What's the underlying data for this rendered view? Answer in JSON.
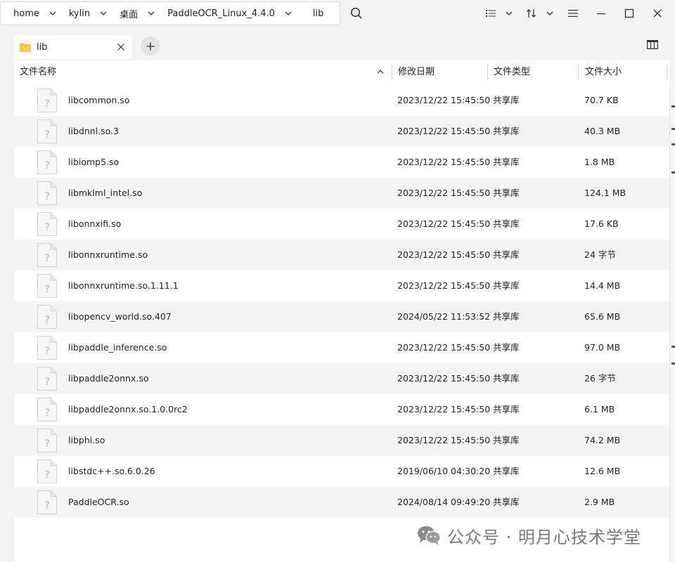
{
  "breadcrumb": [
    "home",
    "kylin",
    "桌面",
    "PaddleOCR_Linux_4.4.0",
    "lib"
  ],
  "tab": {
    "label": "lib"
  },
  "columns": {
    "name": "文件名称",
    "date": "修改日期",
    "type": "文件类型",
    "size": "文件大小"
  },
  "sort": {
    "column": "name",
    "direction": "ascending"
  },
  "files": [
    {
      "name": "libcommon.so",
      "date": "2023/12/22 15:45:50",
      "type": "共享库",
      "size": "70.7 KB"
    },
    {
      "name": "libdnnl.so.3",
      "date": "2023/12/22 15:45:50",
      "type": "共享库",
      "size": "40.3 MB"
    },
    {
      "name": "libiomp5.so",
      "date": "2023/12/22 15:45:50",
      "type": "共享库",
      "size": "1.8 MB"
    },
    {
      "name": "libmklml_intel.so",
      "date": "2023/12/22 15:45:50",
      "type": "共享库",
      "size": "124.1 MB"
    },
    {
      "name": "libonnxifi.so",
      "date": "2023/12/22 15:45:50",
      "type": "共享库",
      "size": "17.6 KB"
    },
    {
      "name": "libonnxruntime.so",
      "date": "2023/12/22 15:45:50",
      "type": "共享库",
      "size": "24 字节"
    },
    {
      "name": "libonnxruntime.so.1.11.1",
      "date": "2023/12/22 15:45:50",
      "type": "共享库",
      "size": "14.4 MB"
    },
    {
      "name": "libopencv_world.so.407",
      "date": "2024/05/22 11:53:52",
      "type": "共享库",
      "size": "65.6 MB"
    },
    {
      "name": "libpaddle_inference.so",
      "date": "2023/12/22 15:45:50",
      "type": "共享库",
      "size": "97.0 MB"
    },
    {
      "name": "libpaddle2onnx.so",
      "date": "2023/12/22 15:45:50",
      "type": "共享库",
      "size": "26 字节"
    },
    {
      "name": "libpaddle2onnx.so.1.0.0rc2",
      "date": "2023/12/22 15:45:50",
      "type": "共享库",
      "size": "6.1 MB"
    },
    {
      "name": "libphi.so",
      "date": "2023/12/22 15:45:50",
      "type": "共享库",
      "size": "74.2 MB"
    },
    {
      "name": "libstdc++.so.6.0.26",
      "date": "2019/06/10 04:30:20",
      "type": "共享库",
      "size": "12.6 MB"
    },
    {
      "name": "PaddleOCR.so",
      "date": "2024/08/14 09:49:20",
      "type": "共享库",
      "size": "2.9 MB"
    }
  ],
  "watermark": {
    "text": "公众号 · 明月心技术学堂",
    "icon": "wechat-icon"
  },
  "icons": {
    "search": "search-icon",
    "view_list": "list-view-icon",
    "sort": "sort-icon",
    "menu": "hamburger-menu-icon",
    "minimize": "minimize-icon",
    "maximize": "maximize-icon",
    "close": "close-icon",
    "folder": "folder-icon",
    "add_tab": "plus-icon",
    "side_panel": "side-panel-icon",
    "file": "unknown-file-icon"
  },
  "colors": {
    "folder": "#f2c232",
    "alt_row": "#f4f4f4",
    "background": "#f3f3f3"
  }
}
